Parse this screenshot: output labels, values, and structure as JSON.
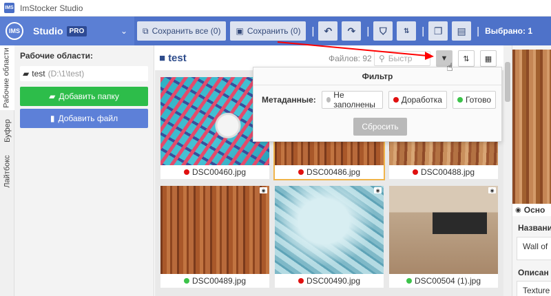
{
  "app": {
    "logo_text": "IMS",
    "title": "ImStocker Studio"
  },
  "brand": {
    "logo_text": "IMS",
    "name": "Studio",
    "badge": "PRO"
  },
  "toolbar": {
    "save_all_label": "Сохранить все (0)",
    "save_label": "Сохранить (0)",
    "selected_label": "Выбрано: 1"
  },
  "vtabs": [
    "Рабочие области",
    "Буфер",
    "Лайтбокс"
  ],
  "left": {
    "title": "Рабочие области:",
    "workspace": {
      "name": "test",
      "path": "(D:\\1\\test)"
    },
    "add_folder": "Добавить папку",
    "add_file": "Добавить файл"
  },
  "main": {
    "folder_title": "test",
    "file_count": "Файлов: 92",
    "search_placeholder": "Быстр"
  },
  "files": [
    {
      "name": "DSC00460.jpg",
      "status": "red",
      "texture": "teal",
      "selected": false
    },
    {
      "name": "DSC00486.jpg",
      "status": "red",
      "texture": "wood1",
      "selected": true
    },
    {
      "name": "DSC00488.jpg",
      "status": "red",
      "texture": "wood2",
      "selected": false
    },
    {
      "name": "DSC00489.jpg",
      "status": "green",
      "texture": "wood1",
      "selected": false
    },
    {
      "name": "DSC00490.jpg",
      "status": "red",
      "texture": "blue",
      "selected": false
    },
    {
      "name": "DSC00504 (1).jpg",
      "status": "green",
      "texture": "desk",
      "selected": false
    }
  ],
  "filter": {
    "title": "Фильтр",
    "metadata_label": "Метаданные:",
    "options": [
      {
        "label": "Не заполнены",
        "color": "#bbbbbb"
      },
      {
        "label": "Доработка",
        "color": "#e01010"
      },
      {
        "label": "Готово",
        "color": "#3cc34a"
      }
    ],
    "reset": "Сбросить"
  },
  "right": {
    "tab": "Осно",
    "name_label": "Названи",
    "name_value": "Wall of",
    "desc_label": "Описан",
    "desc_value": "Texture"
  },
  "colors": {
    "accent": "#4e72c9",
    "red": "#e01010",
    "green": "#3cc34a",
    "annotation": "#ff0000"
  }
}
